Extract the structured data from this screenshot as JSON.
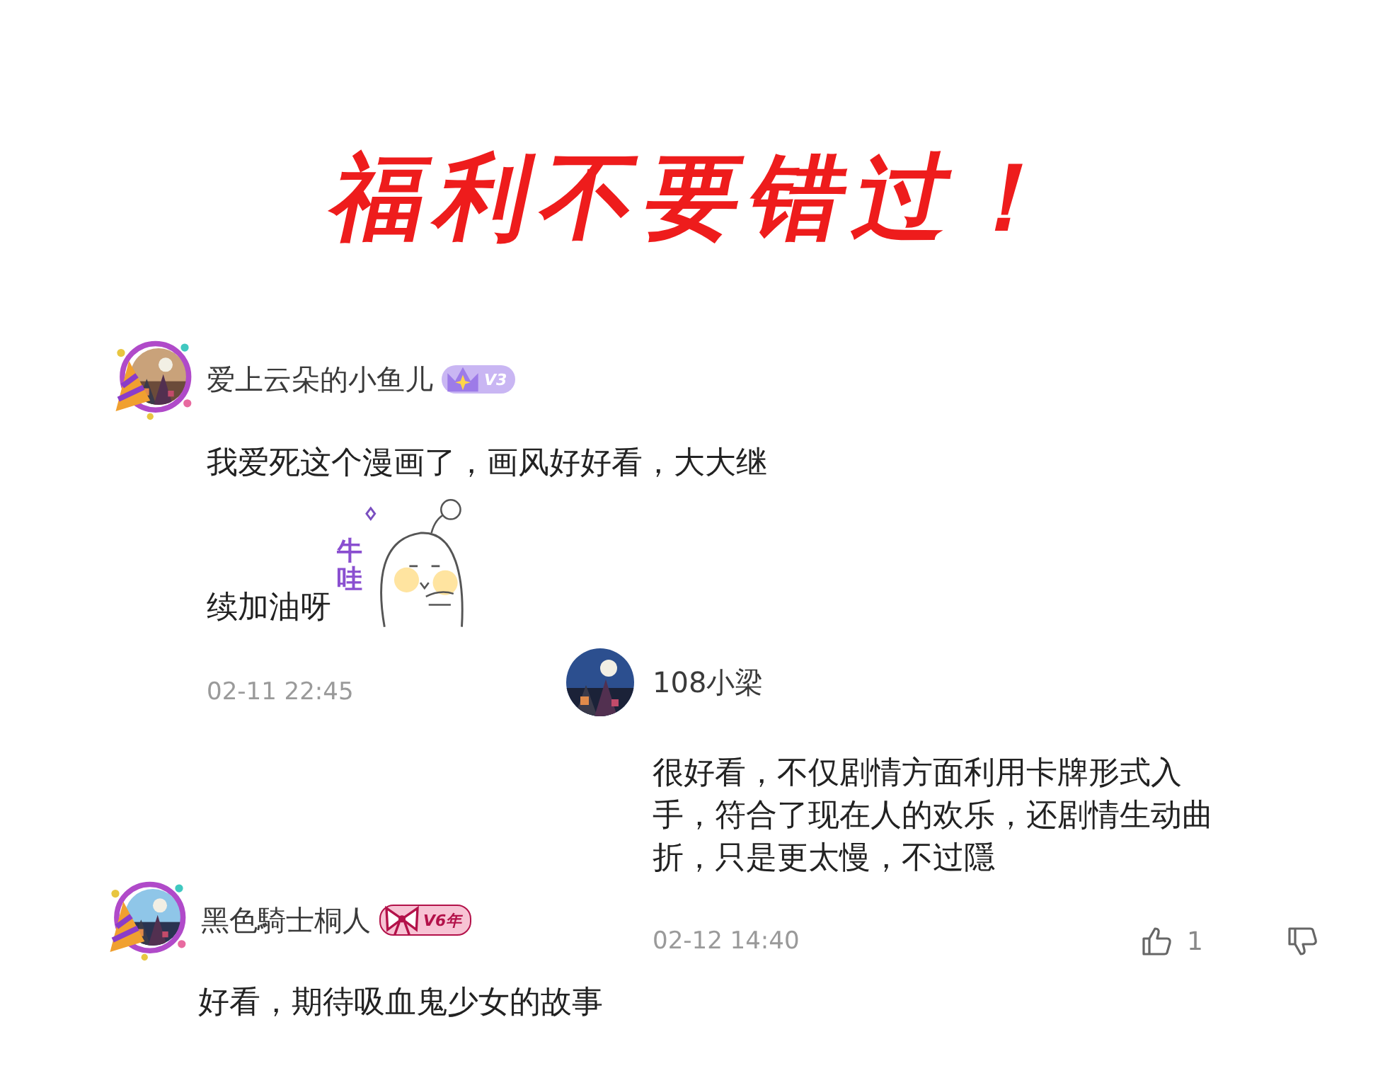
{
  "title": "福利不要错过！",
  "comments": [
    {
      "user": "爱上云朵的小鱼儿",
      "avatar_frame": true,
      "badge": {
        "kind": "crown",
        "text": "V3"
      },
      "lines": [
        "我爱死这个漫画了，画风好好看，大大继",
        "续加油呀"
      ],
      "sticker": {
        "text": "牛哇"
      },
      "time": "02-11 22:45"
    },
    {
      "user": "108小梁",
      "avatar_frame": false,
      "lines": [
        "很好看，不仅剧情方面利用卡牌形式入",
        "手，符合了现在人的欢乐，还剧情生动曲",
        "折，只是更太慢，不过隱"
      ],
      "time": "02-12 14:40",
      "likes": "1"
    },
    {
      "user": "黑色騎士桐人",
      "avatar_frame": true,
      "badge": {
        "kind": "bow",
        "text": "V6年"
      },
      "lines": [
        "好看，期待吸血鬼少女的故事"
      ]
    }
  ]
}
